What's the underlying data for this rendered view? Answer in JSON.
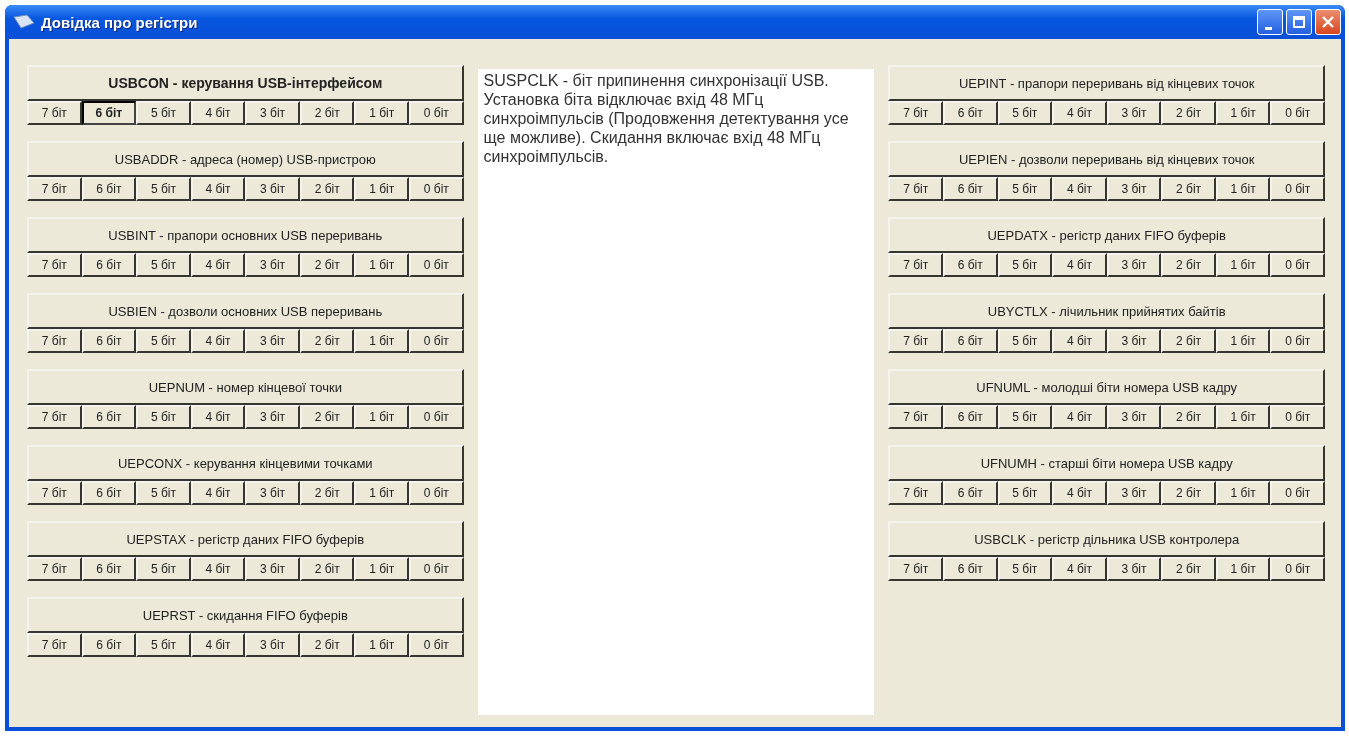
{
  "window": {
    "title": "Довідка про регістри"
  },
  "left_registers": [
    {
      "label": "USBCON - керування USB-інтерфейсом",
      "selected": true,
      "bits": [
        {
          "label": "7 біт",
          "selected": false
        },
        {
          "label": "6 біт",
          "selected": true
        },
        {
          "label": "5 біт",
          "selected": false
        },
        {
          "label": "4 біт",
          "selected": false
        },
        {
          "label": "3 біт",
          "selected": false
        },
        {
          "label": "2 біт",
          "selected": false
        },
        {
          "label": "1 біт",
          "selected": false
        },
        {
          "label": "0 біт",
          "selected": false
        }
      ]
    },
    {
      "label": "USBADDR - адреса (номер) USB-пристрою",
      "selected": false,
      "bits": [
        {
          "label": "7 біт",
          "selected": false
        },
        {
          "label": "6 біт",
          "selected": false
        },
        {
          "label": "5 біт",
          "selected": false
        },
        {
          "label": "4 біт",
          "selected": false
        },
        {
          "label": "3 біт",
          "selected": false
        },
        {
          "label": "2 біт",
          "selected": false
        },
        {
          "label": "1 біт",
          "selected": false
        },
        {
          "label": "0 біт",
          "selected": false
        }
      ]
    },
    {
      "label": "USBINT - прапори основних USB переривань",
      "selected": false,
      "bits": [
        {
          "label": "7 біт",
          "selected": false
        },
        {
          "label": "6 біт",
          "selected": false
        },
        {
          "label": "5 біт",
          "selected": false
        },
        {
          "label": "4 біт",
          "selected": false
        },
        {
          "label": "3 біт",
          "selected": false
        },
        {
          "label": "2 біт",
          "selected": false
        },
        {
          "label": "1 біт",
          "selected": false
        },
        {
          "label": "0 біт",
          "selected": false
        }
      ]
    },
    {
      "label": "USBIEN - дозволи основних USB переривань",
      "selected": false,
      "bits": [
        {
          "label": "7 біт",
          "selected": false
        },
        {
          "label": "6 біт",
          "selected": false
        },
        {
          "label": "5 біт",
          "selected": false
        },
        {
          "label": "4 біт",
          "selected": false
        },
        {
          "label": "3 біт",
          "selected": false
        },
        {
          "label": "2 біт",
          "selected": false
        },
        {
          "label": "1 біт",
          "selected": false
        },
        {
          "label": "0 біт",
          "selected": false
        }
      ]
    },
    {
      "label": "UEPNUM - номер кінцевої точки",
      "selected": false,
      "bits": [
        {
          "label": "7 біт",
          "selected": false
        },
        {
          "label": "6 біт",
          "selected": false
        },
        {
          "label": "5 біт",
          "selected": false
        },
        {
          "label": "4 біт",
          "selected": false
        },
        {
          "label": "3 біт",
          "selected": false
        },
        {
          "label": "2 біт",
          "selected": false
        },
        {
          "label": "1 біт",
          "selected": false
        },
        {
          "label": "0 біт",
          "selected": false
        }
      ]
    },
    {
      "label": "UEPCONX - керування кінцевими точками",
      "selected": false,
      "bits": [
        {
          "label": "7 біт",
          "selected": false
        },
        {
          "label": "6 біт",
          "selected": false
        },
        {
          "label": "5 біт",
          "selected": false
        },
        {
          "label": "4 біт",
          "selected": false
        },
        {
          "label": "3 біт",
          "selected": false
        },
        {
          "label": "2 біт",
          "selected": false
        },
        {
          "label": "1 біт",
          "selected": false
        },
        {
          "label": "0 біт",
          "selected": false
        }
      ]
    },
    {
      "label": "UEPSTAX - регістр даних FIFO буферів",
      "selected": false,
      "bits": [
        {
          "label": "7 біт",
          "selected": false
        },
        {
          "label": "6 біт",
          "selected": false
        },
        {
          "label": "5 біт",
          "selected": false
        },
        {
          "label": "4 біт",
          "selected": false
        },
        {
          "label": "3 біт",
          "selected": false
        },
        {
          "label": "2 біт",
          "selected": false
        },
        {
          "label": "1 біт",
          "selected": false
        },
        {
          "label": "0 біт",
          "selected": false
        }
      ]
    },
    {
      "label": "UEPRST - скидання FIFO буферів",
      "selected": false,
      "bits": [
        {
          "label": "7 біт",
          "selected": false
        },
        {
          "label": "6 біт",
          "selected": false
        },
        {
          "label": "5 біт",
          "selected": false
        },
        {
          "label": "4 біт",
          "selected": false
        },
        {
          "label": "3 біт",
          "selected": false
        },
        {
          "label": "2 біт",
          "selected": false
        },
        {
          "label": "1 біт",
          "selected": false
        },
        {
          "label": "0 біт",
          "selected": false
        }
      ]
    }
  ],
  "description": "SUSPCLK - біт припинення синхронізації USB. Установка біта відключає вхід 48 МГц синхроімпульсів (Продовження детектування усе ще можливе). Скидання включає вхід 48 МГц синхроімпульсів.",
  "right_registers": [
    {
      "label": "UEPINT - прапори переривань від кінцевих точок",
      "selected": false,
      "bits": [
        {
          "label": "7 біт",
          "selected": false
        },
        {
          "label": "6 біт",
          "selected": false
        },
        {
          "label": "5 біт",
          "selected": false
        },
        {
          "label": "4 біт",
          "selected": false
        },
        {
          "label": "3 біт",
          "selected": false
        },
        {
          "label": "2 біт",
          "selected": false
        },
        {
          "label": "1 біт",
          "selected": false
        },
        {
          "label": "0 біт",
          "selected": false
        }
      ]
    },
    {
      "label": "UEPIEN - дозволи переривань від кінцевих точок",
      "selected": false,
      "bits": [
        {
          "label": "7 біт",
          "selected": false
        },
        {
          "label": "6 біт",
          "selected": false
        },
        {
          "label": "5 біт",
          "selected": false
        },
        {
          "label": "4 біт",
          "selected": false
        },
        {
          "label": "3 біт",
          "selected": false
        },
        {
          "label": "2 біт",
          "selected": false
        },
        {
          "label": "1 біт",
          "selected": false
        },
        {
          "label": "0 біт",
          "selected": false
        }
      ]
    },
    {
      "label": "UEPDATX - регістр даних FIFO буферів",
      "selected": false,
      "bits": [
        {
          "label": "7 біт",
          "selected": false
        },
        {
          "label": "6 біт",
          "selected": false
        },
        {
          "label": "5 біт",
          "selected": false
        },
        {
          "label": "4 біт",
          "selected": false
        },
        {
          "label": "3 біт",
          "selected": false
        },
        {
          "label": "2 біт",
          "selected": false
        },
        {
          "label": "1 біт",
          "selected": false
        },
        {
          "label": "0 біт",
          "selected": false
        }
      ]
    },
    {
      "label": "UBYCTLX - лічильник прийнятих байтів",
      "selected": false,
      "bits": [
        {
          "label": "7 біт",
          "selected": false
        },
        {
          "label": "6 біт",
          "selected": false
        },
        {
          "label": "5 біт",
          "selected": false
        },
        {
          "label": "4 біт",
          "selected": false
        },
        {
          "label": "3 біт",
          "selected": false
        },
        {
          "label": "2 біт",
          "selected": false
        },
        {
          "label": "1 біт",
          "selected": false
        },
        {
          "label": "0 біт",
          "selected": false
        }
      ]
    },
    {
      "label": "UFNUML - молодші біти номера USB кадру",
      "selected": false,
      "bits": [
        {
          "label": "7 біт",
          "selected": false
        },
        {
          "label": "6 біт",
          "selected": false
        },
        {
          "label": "5 біт",
          "selected": false
        },
        {
          "label": "4 біт",
          "selected": false
        },
        {
          "label": "3 біт",
          "selected": false
        },
        {
          "label": "2 біт",
          "selected": false
        },
        {
          "label": "1 біт",
          "selected": false
        },
        {
          "label": "0 біт",
          "selected": false
        }
      ]
    },
    {
      "label": "UFNUMH - старші біти номера USB кадру",
      "selected": false,
      "bits": [
        {
          "label": "7 біт",
          "selected": false
        },
        {
          "label": "6 біт",
          "selected": false
        },
        {
          "label": "5 біт",
          "selected": false
        },
        {
          "label": "4 біт",
          "selected": false
        },
        {
          "label": "3 біт",
          "selected": false
        },
        {
          "label": "2 біт",
          "selected": false
        },
        {
          "label": "1 біт",
          "selected": false
        },
        {
          "label": "0 біт",
          "selected": false
        }
      ]
    },
    {
      "label": "USBCLK - регістр дільника USB контролера",
      "selected": false,
      "bits": [
        {
          "label": "7 біт",
          "selected": false
        },
        {
          "label": "6 біт",
          "selected": false
        },
        {
          "label": "5 біт",
          "selected": false
        },
        {
          "label": "4 біт",
          "selected": false
        },
        {
          "label": "3 біт",
          "selected": false
        },
        {
          "label": "2 біт",
          "selected": false
        },
        {
          "label": "1 біт",
          "selected": false
        },
        {
          "label": "0 біт",
          "selected": false
        }
      ]
    }
  ]
}
